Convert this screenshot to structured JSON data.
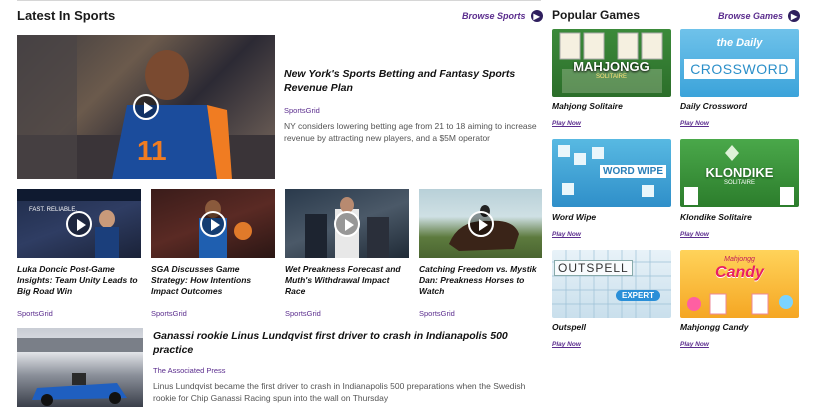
{
  "sports": {
    "title": "Latest In Sports",
    "browse_label": "Browse Sports",
    "featured": {
      "headline": "New York's Sports Betting and Fantasy Sports Revenue Plan",
      "source": "SportsGrid",
      "description": "NY considers lowering betting age from 21 to 18 aiming to increase revenue by attracting new players, and a $5M operator"
    },
    "cards": [
      {
        "headline": "Luka Doncic Post-Game Insights: Team Unity Leads to Big Road Win",
        "source": "SportsGrid"
      },
      {
        "headline": "SGA Discusses Game Strategy: How Intentions Impact Outcomes",
        "source": "SportsGrid"
      },
      {
        "headline": "Wet Preakness Forecast and Muth's Withdrawal Impact Race",
        "source": "SportsGrid"
      },
      {
        "headline": "Catching Freedom vs. Mystik Dan: Preakness Horses to Watch",
        "source": "SportsGrid"
      }
    ],
    "bottom_story": {
      "headline": "Ganassi rookie Linus Lundqvist first driver to crash in Indianapolis 500 practice",
      "source": "The Associated Press",
      "description": "Linus Lundqvist became the first driver to crash in Indianapolis 500 preparations when the Swedish rookie for Chip Ganassi Racing spun into the wall on Thursday"
    }
  },
  "games": {
    "title": "Popular Games",
    "browse_label": "Browse Games",
    "play_label": "Play Now",
    "items": [
      {
        "name": "Mahjong Solitaire",
        "art_text": "MAHJONGG",
        "art_sub": "SOLITAIRE"
      },
      {
        "name": "Daily Crossword",
        "art_text": "CROSSWORD",
        "art_sub": "the Daily"
      },
      {
        "name": "Word Wipe",
        "art_text": "WORD WIPE",
        "art_sub": ""
      },
      {
        "name": "Klondike Solitaire",
        "art_text": "KLONDIKE",
        "art_sub": "SOLITAIRE"
      },
      {
        "name": "Outspell",
        "art_text": "OUTSPELL",
        "art_sub": "EXPERT"
      },
      {
        "name": "Mahjongg Candy",
        "art_text": "Candy",
        "art_sub": "Mahjongg"
      }
    ]
  },
  "colors": {
    "accent": "#5b2d8e",
    "arrow_bg": "#2f1f5e"
  }
}
